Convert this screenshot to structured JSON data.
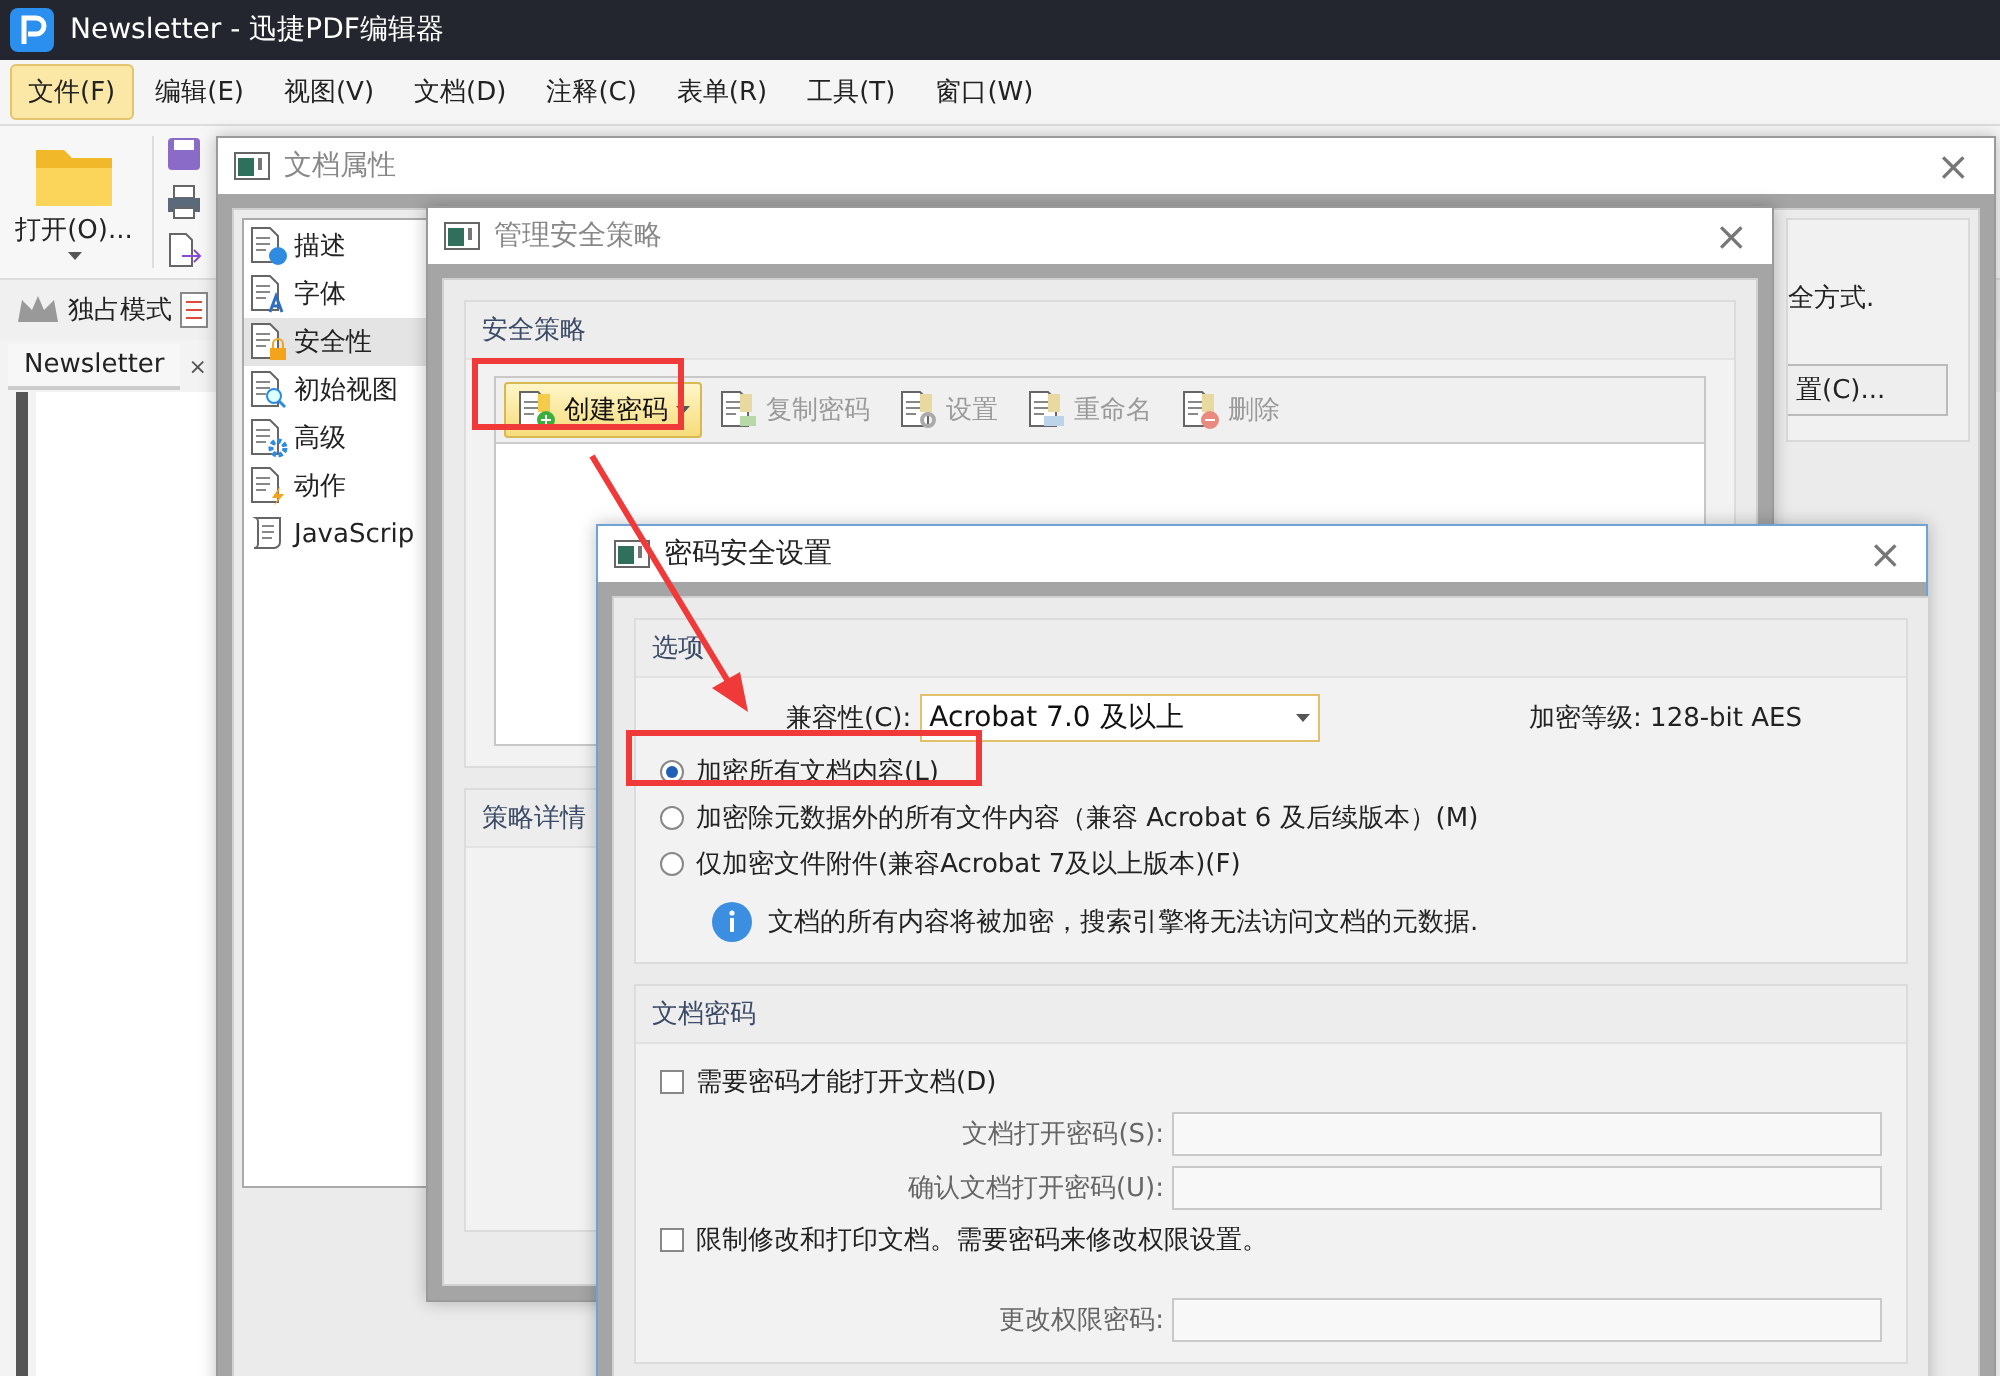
{
  "app": {
    "title": "Newsletter - 迅捷PDF编辑器",
    "menu": [
      {
        "label": "文件(F)",
        "selected": true
      },
      {
        "label": "编辑(E)",
        "selected": false
      },
      {
        "label": "视图(V)",
        "selected": false
      },
      {
        "label": "文档(D)",
        "selected": false
      },
      {
        "label": "注释(C)",
        "selected": false
      },
      {
        "label": "表单(R)",
        "selected": false
      },
      {
        "label": "工具(T)",
        "selected": false
      },
      {
        "label": "窗口(W)",
        "selected": false
      }
    ],
    "open_button": "打开(O)...",
    "mode_label": "独占模式",
    "doc_tab": {
      "label": "Newsletter",
      "close": "×"
    }
  },
  "properties_dialog": {
    "title": "文档属性",
    "close": "×",
    "nav": [
      {
        "label": "描述",
        "selected": false
      },
      {
        "label": "字体",
        "selected": false
      },
      {
        "label": "安全性",
        "selected": true
      },
      {
        "label": "初始视图",
        "selected": false
      },
      {
        "label": "高级",
        "selected": false
      },
      {
        "label": "动作",
        "selected": false
      },
      {
        "label": "JavaScrip",
        "selected": false
      }
    ],
    "partial_text": "全方式.",
    "partial_button": "置(C)..."
  },
  "policy_dialog": {
    "title": "管理安全策略",
    "close": "×",
    "group": "安全策略",
    "toolbar": [
      {
        "label": "创建密码",
        "disabled": false,
        "dropdown": true
      },
      {
        "label": "复制密码",
        "disabled": true,
        "dropdown": false
      },
      {
        "label": "设置",
        "disabled": true,
        "dropdown": false
      },
      {
        "label": "重命名",
        "disabled": true,
        "dropdown": false
      },
      {
        "label": "删除",
        "disabled": true,
        "dropdown": false
      }
    ],
    "details_group": "策略详情"
  },
  "password_dialog": {
    "title": "密码安全设置",
    "close": "×",
    "options_group": "选项",
    "compat_label": "兼容性(C):",
    "compat_value": "Acrobat 7.0 及以上",
    "level_text": "加密等级: 128-bit AES",
    "radios": [
      {
        "label": "加密所有文档内容(L)",
        "selected": true
      },
      {
        "label": "加密除元数据外的所有文件内容（兼容 Acrobat 6 及后续版本）(M)",
        "selected": false
      },
      {
        "label": "仅加密文件附件(兼容Acrobat 7及以上版本)(F)",
        "selected": false
      }
    ],
    "info": "文档的所有内容将被加密，搜索引擎将无法访问文档的元数据.",
    "password_group": "文档密码",
    "open_check": {
      "label": "需要密码才能打开文档(D)",
      "checked": false
    },
    "open_fields": [
      {
        "label": "文档打开密码(S):"
      },
      {
        "label": "确认文档打开密码(U):"
      }
    ],
    "restrict_check": {
      "label": "限制修改和打印文档。需要密码来修改权限设置。",
      "checked": false
    },
    "perm_field": {
      "label": "更改权限密码:"
    }
  }
}
